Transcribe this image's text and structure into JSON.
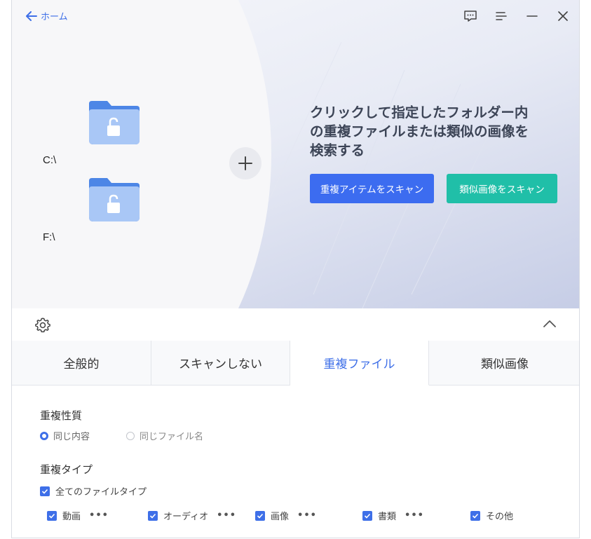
{
  "nav": {
    "back_label": "ホーム"
  },
  "window_controls": [
    "feedback-icon",
    "menu-icon",
    "minimize-icon",
    "close-icon"
  ],
  "drives": [
    {
      "label": "C:\\",
      "icon": "locked-folder-icon"
    },
    {
      "label": "F:\\",
      "icon": "locked-folder-icon"
    }
  ],
  "hero": {
    "headline_lines": [
      "クリックして指定したフォルダー内",
      "の重複ファイルまたは類似の画像を",
      "検索する"
    ],
    "scan_duplicates_label": "重複アイテムをスキャン",
    "scan_similar_label": "類似画像をスキャン"
  },
  "tabs": [
    {
      "label": "全般的",
      "active": false
    },
    {
      "label": "スキャンしない",
      "active": false
    },
    {
      "label": "重複ファイル",
      "active": true
    },
    {
      "label": "類似画像",
      "active": false
    }
  ],
  "duplicate_nature": {
    "title": "重複性質",
    "options": [
      {
        "label": "同じ内容",
        "selected": true
      },
      {
        "label": "同じファイル名",
        "selected": false
      }
    ]
  },
  "duplicate_type": {
    "title": "重複タイプ",
    "all_label": "全てのファイルタイプ",
    "types": [
      {
        "label": "動画",
        "more": "•••"
      },
      {
        "label": "オーディオ",
        "more": "•••"
      },
      {
        "label": "画像",
        "more": "•••"
      },
      {
        "label": "書類",
        "more": "•••"
      },
      {
        "label": "その他",
        "more": ""
      }
    ]
  },
  "colors": {
    "accent": "#3c6cf0",
    "teal": "#20bfa8",
    "text": "#3c4456"
  }
}
